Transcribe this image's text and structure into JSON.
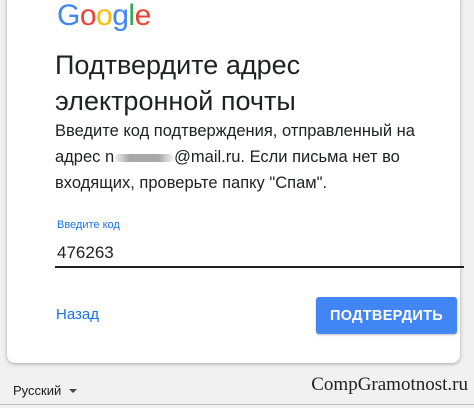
{
  "logo": {
    "letters": [
      "G",
      "o",
      "o",
      "g",
      "l",
      "e"
    ],
    "colors": [
      "#4285f4",
      "#ea4335",
      "#fbbc05",
      "#4285f4",
      "#34a853",
      "#ea4335"
    ]
  },
  "page": {
    "title_line1": "Подтвердите адрес",
    "title_line2": "электронной почты",
    "desc_part1": "Введите код подтверждения, отправленный на адрес n",
    "desc_part2": "@mail.ru. Если письма нет во входящих, проверьте папку \"Спам\"."
  },
  "code_field": {
    "label": "Введите код",
    "value": "476263"
  },
  "actions": {
    "back_label": "Назад",
    "confirm_label": "ПОДТВЕРДИТЬ"
  },
  "footer": {
    "language": "Русский"
  },
  "watermark": "CompGramotnost.ru",
  "colors": {
    "accent": "#1a73e8",
    "button": "#4285f4"
  }
}
